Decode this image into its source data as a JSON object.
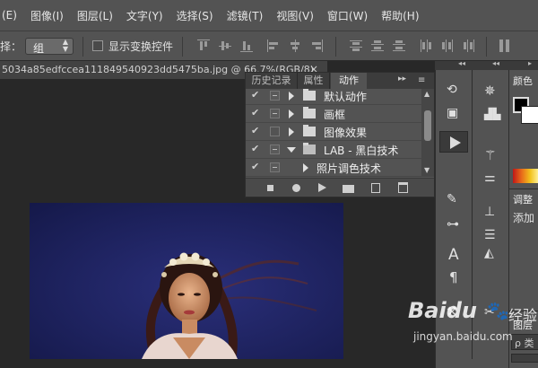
{
  "menubar": {
    "items": [
      "(E)",
      "图像(I)",
      "图层(L)",
      "文字(Y)",
      "选择(S)",
      "滤镜(T)",
      "视图(V)",
      "窗口(W)",
      "帮助(H)"
    ]
  },
  "options_bar": {
    "select_label": "择：",
    "select_value": "组",
    "show_transform_label": "显示变换控件"
  },
  "document": {
    "tab_title": "5034a85edfccea111849540923dd5475ba.jpg @ 66.7%(RGB/8)",
    "close_glyph": "×"
  },
  "actions_panel": {
    "tabs": [
      "历史记录",
      "属性",
      "动作"
    ],
    "active_tab": "动作",
    "menu_glyph": "▸▸",
    "rows": [
      {
        "label": "默认动作",
        "kind": "set",
        "expanded": false
      },
      {
        "label": "画框",
        "kind": "set",
        "expanded": false
      },
      {
        "label": "图像效果",
        "kind": "set",
        "expanded": false
      },
      {
        "label": "LAB - 黑白技术",
        "kind": "set",
        "expanded": true
      },
      {
        "label": "照片调色技术",
        "kind": "action",
        "expanded": false
      }
    ]
  },
  "right_panel": {
    "color_title": "颜色",
    "adjust_title": "调整",
    "adjust_add": "添加",
    "layers_title": "图层",
    "search_glyph": "ρ 类"
  },
  "toolstrip": {
    "text_tool": "A",
    "paragraph_tool": "¶"
  },
  "watermark": {
    "logo_text": "Baidu",
    "logo_suffix": "经验",
    "url": "jingyan.baidu.com"
  },
  "colors": {
    "ui_dark": "#535353",
    "canvas_bg": "#282828",
    "photo_bg": "#1c2160"
  }
}
